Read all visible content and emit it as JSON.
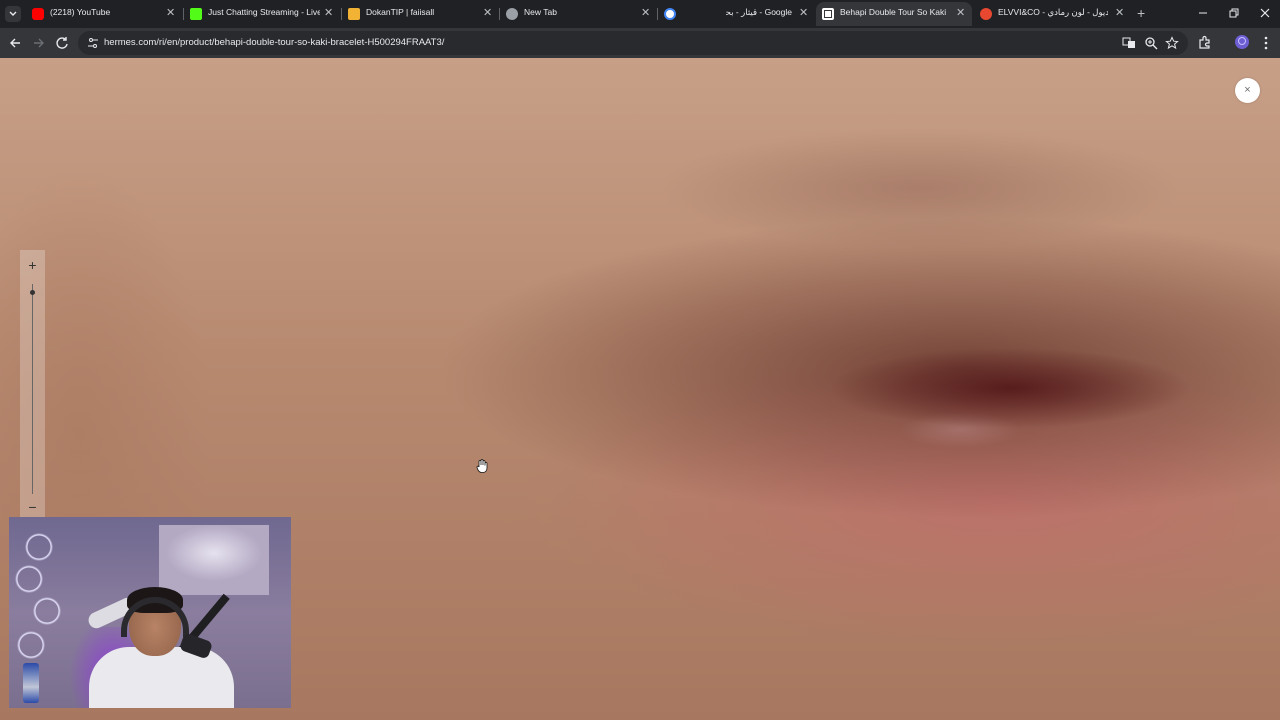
{
  "browser": {
    "tabs": [
      {
        "title": "(2218) YouTube",
        "favicon": "youtube-icon",
        "color": "#ff0000",
        "active": false
      },
      {
        "title": "Just Chatting Streaming - Live S",
        "favicon": "kick-icon",
        "color": "#53fc18",
        "active": false
      },
      {
        "title": "DokanTIP | faiisall",
        "favicon": "dokantip-icon",
        "color": "#f2b233",
        "active": false
      },
      {
        "title": "New Tab",
        "favicon": "chrome-icon",
        "color": "#9aa0a6",
        "active": false
      },
      {
        "title": "Google - قيثار - بحث",
        "favicon": "google-icon",
        "color": "#4285f4",
        "active": false
      },
      {
        "title": "Behapi Double Tour So Kaki br",
        "favicon": "hermes-icon",
        "color": "#ffffff",
        "active": true
      },
      {
        "title": "ELVVI&CO - ترينديول - لون رمادي",
        "favicon": "elvvi-icon",
        "color": "#e8482f",
        "active": false
      }
    ],
    "url": "hermes.com/ri/en/product/behapi-double-tour-so-kaki-bracelet-H500294FRAAT3/",
    "accent_color": "#35363a"
  },
  "viewer": {
    "zoom_in_label": "+",
    "zoom_out_label": "−",
    "close_label": "×",
    "zoom_level": 0.96
  }
}
